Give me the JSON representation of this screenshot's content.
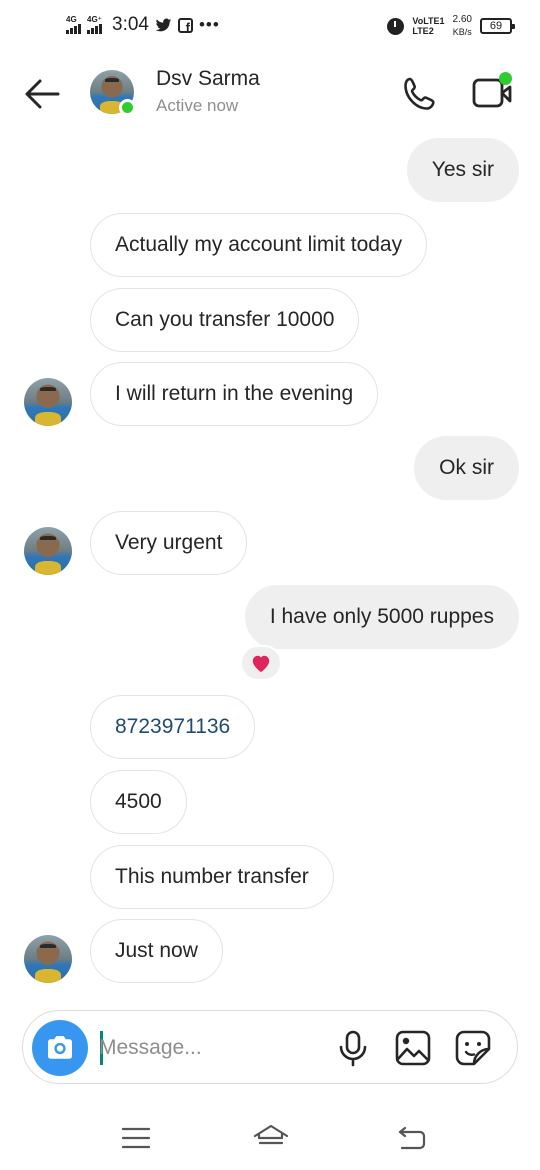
{
  "status_bar": {
    "network_1": "4G",
    "network_2": "4G⁺",
    "time": "3:04",
    "volte_1": "VoLTE1",
    "volte_2": "LTE2",
    "speed_value": "2.60",
    "speed_unit": "KB/s",
    "battery": "69"
  },
  "header": {
    "contact_name": "Dsv Sarma",
    "contact_status": "Active now"
  },
  "messages": [
    {
      "direction": "out",
      "text": "Yes sir"
    },
    {
      "direction": "in",
      "text": "Actually my account limit today"
    },
    {
      "direction": "in",
      "text": "Can you transfer 10000"
    },
    {
      "direction": "in",
      "text": "I will return in the evening",
      "avatar": true
    },
    {
      "direction": "out",
      "text": "Ok sir"
    },
    {
      "direction": "in",
      "text": "Very urgent",
      "avatar": true
    },
    {
      "direction": "out",
      "text": "I have only 5000 ruppes",
      "reaction": "heart"
    },
    {
      "direction": "in",
      "text": "8723971136",
      "link": true
    },
    {
      "direction": "in",
      "text": "4500"
    },
    {
      "direction": "in",
      "text": "This number transfer"
    },
    {
      "direction": "in",
      "text": "Just now",
      "avatar": true
    }
  ],
  "composer": {
    "placeholder": "Message..."
  },
  "colors": {
    "accent": "#3797f0",
    "online": "#2ecc2e",
    "reaction": "#e0245e",
    "link": "#1f4b73"
  },
  "icons": [
    "back-arrow-icon",
    "phone-icon",
    "video-icon",
    "camera-icon",
    "microphone-icon",
    "gallery-icon",
    "sticker-icon",
    "heart-icon",
    "nav-menu-icon",
    "nav-home-icon",
    "nav-back-icon"
  ]
}
